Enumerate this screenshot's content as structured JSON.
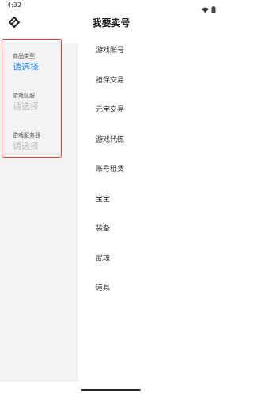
{
  "status_bar": {
    "time": "4:32"
  },
  "header": {
    "title": "我要卖号"
  },
  "filters": [
    {
      "label": "商品类型",
      "value": "请选择",
      "state": "active"
    },
    {
      "label": "游戏区服",
      "value": "请选择",
      "state": "disabled"
    },
    {
      "label": "游戏服务器",
      "value": "请选择",
      "state": "disabled"
    }
  ],
  "categories": [
    {
      "label": "游戏账号"
    },
    {
      "label": "担保交易"
    },
    {
      "label": "元宝交易"
    },
    {
      "label": "游戏代练"
    },
    {
      "label": "账号租赁"
    },
    {
      "label": "宝宝"
    },
    {
      "label": "装备"
    },
    {
      "label": "武魂"
    },
    {
      "label": "道具"
    }
  ],
  "colors": {
    "accent": "#1e88e5",
    "highlight_border": "#e53935",
    "panel_bg": "#f2f2f2",
    "disabled_text": "#bbbbbb"
  },
  "icons": {
    "back": "diamond-back-icon",
    "wifi": "wifi-icon",
    "battery": "battery-icon"
  }
}
